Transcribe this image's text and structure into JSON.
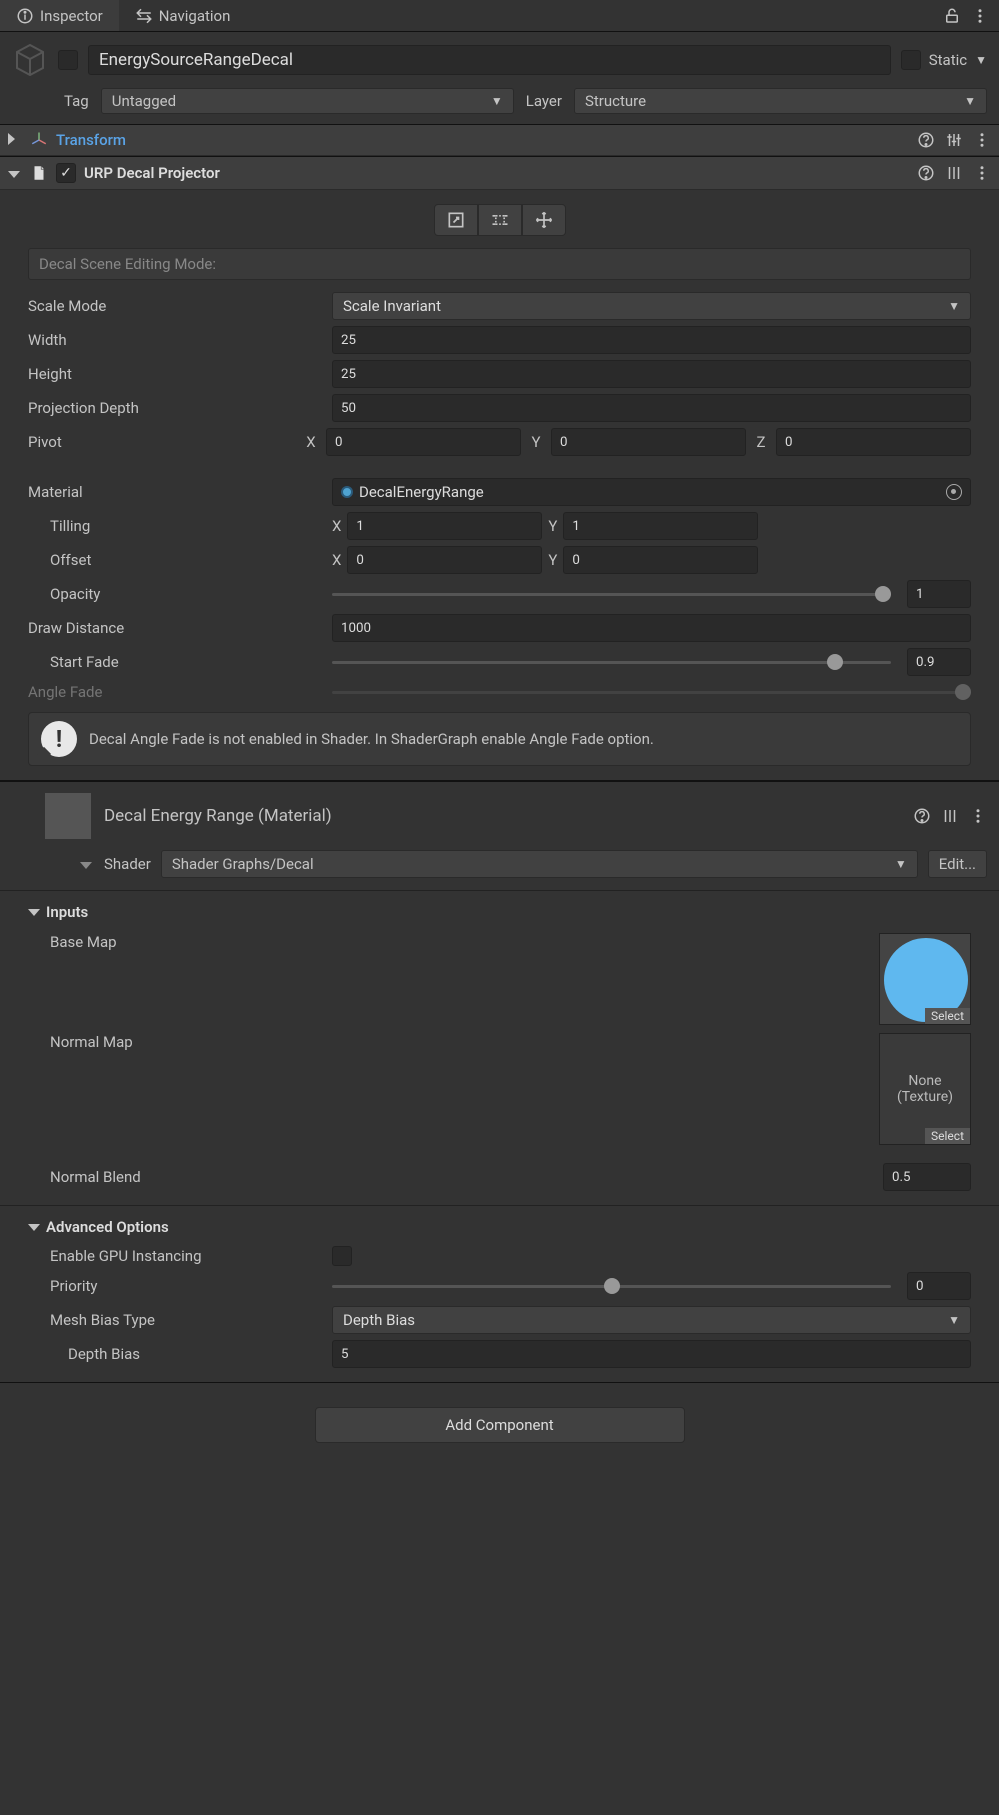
{
  "tabs": {
    "inspector": "Inspector",
    "navigation": "Navigation"
  },
  "gameobject": {
    "name": "EnergySourceRangeDecal",
    "static_label": "Static",
    "tag_label": "Tag",
    "tag_value": "Untagged",
    "layer_label": "Layer",
    "layer_value": "Structure"
  },
  "transform": {
    "title": "Transform"
  },
  "decal": {
    "title": "URP Decal Projector",
    "editing_mode_label": "Decal Scene Editing Mode:",
    "scale_mode_label": "Scale Mode",
    "scale_mode_value": "Scale Invariant",
    "width_label": "Width",
    "width_value": "25",
    "height_label": "Height",
    "height_value": "25",
    "proj_depth_label": "Projection Depth",
    "proj_depth_value": "50",
    "pivot_label": "Pivot",
    "pivot_x": "0",
    "pivot_y": "0",
    "pivot_z": "0",
    "material_label": "Material",
    "material_value": "DecalEnergyRange",
    "tilling_label": "Tilling",
    "tilling_x": "1",
    "tilling_y": "1",
    "offset_label": "Offset",
    "offset_x": "0",
    "offset_y": "0",
    "opacity_label": "Opacity",
    "opacity_value": "1",
    "draw_dist_label": "Draw Distance",
    "draw_dist_value": "1000",
    "start_fade_label": "Start Fade",
    "start_fade_value": "0.9",
    "angle_fade_label": "Angle Fade",
    "info_text": "Decal Angle Fade is not enabled in Shader. In ShaderGraph enable Angle Fade option."
  },
  "material": {
    "title": "Decal Energy Range (Material)",
    "shader_label": "Shader",
    "shader_value": "Shader Graphs/Decal",
    "edit_btn": "Edit...",
    "inputs_label": "Inputs",
    "basemap_label": "Base Map",
    "normalmap_label": "Normal Map",
    "normalmap_none": "None",
    "normalmap_texture": "(Texture)",
    "select_label": "Select",
    "normal_blend_label": "Normal Blend",
    "normal_blend_value": "0.5",
    "adv_label": "Advanced Options",
    "gpu_instancing_label": "Enable GPU Instancing",
    "priority_label": "Priority",
    "priority_value": "0",
    "mesh_bias_type_label": "Mesh Bias Type",
    "mesh_bias_type_value": "Depth Bias",
    "depth_bias_label": "Depth Bias",
    "depth_bias_value": "5"
  },
  "add_component": "Add Component",
  "axes": {
    "x": "X",
    "y": "Y",
    "z": "Z"
  }
}
